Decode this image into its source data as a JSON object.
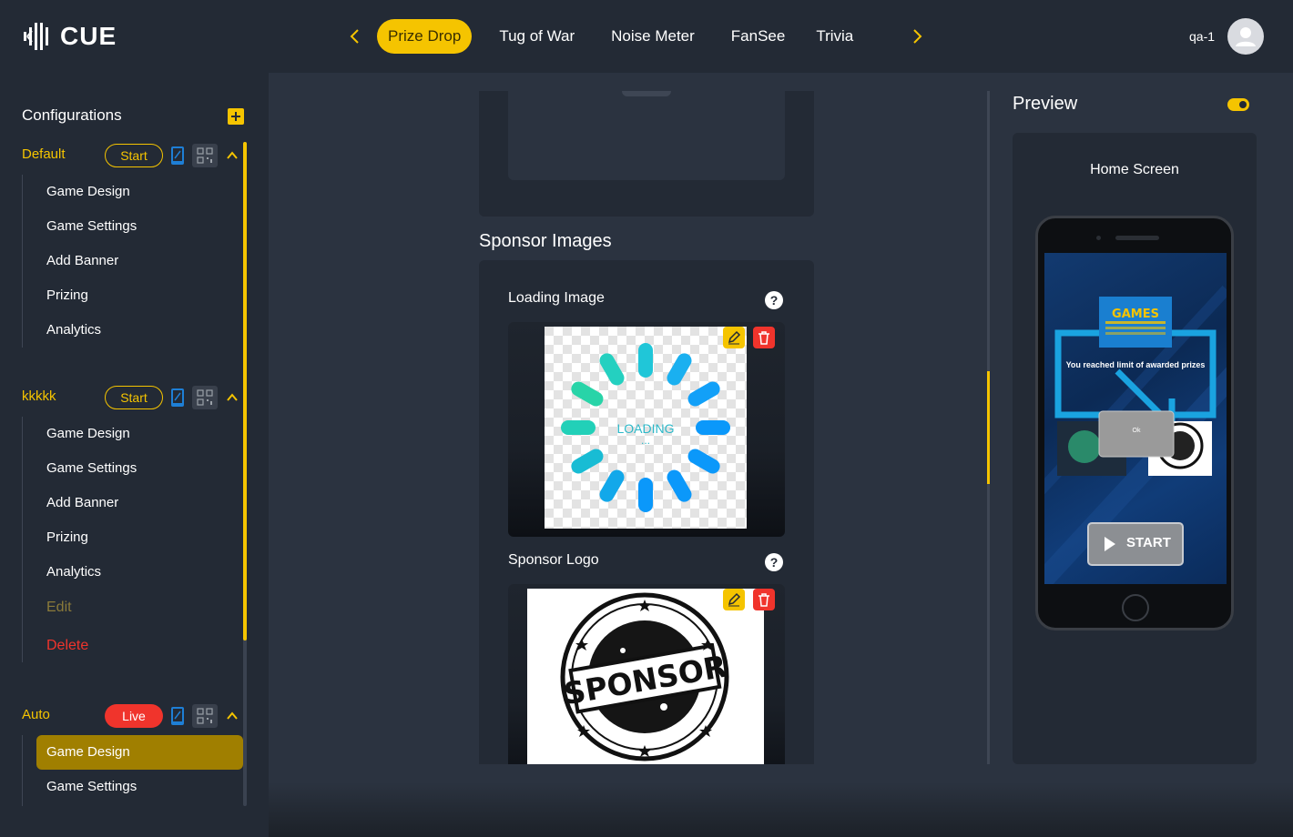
{
  "brand": {
    "name": "CUE"
  },
  "top_nav": {
    "tabs": [
      {
        "label": "Prize Drop",
        "active": true
      },
      {
        "label": "Tug of War",
        "active": false
      },
      {
        "label": "Noise Meter",
        "active": false
      },
      {
        "label": "FanSee",
        "active": false
      },
      {
        "label": "Trivia",
        "active": false
      }
    ],
    "user": {
      "name": "qa-1"
    }
  },
  "sidebar": {
    "title": "Configurations",
    "groups": [
      {
        "name": "Default",
        "status_label": "Start",
        "items": [
          "Game Design",
          "Game Settings",
          "Add Banner",
          "Prizing",
          "Analytics"
        ]
      },
      {
        "name": "kkkkk",
        "status_label": "Start",
        "items": [
          "Game Design",
          "Game Settings",
          "Add Banner",
          "Prizing",
          "Analytics"
        ],
        "actions": {
          "edit": "Edit",
          "delete": "Delete"
        }
      },
      {
        "name": "Auto",
        "status_label": "Live",
        "items": [
          "Game Design",
          "Game Settings"
        ],
        "active_item": "Game Design"
      }
    ]
  },
  "main": {
    "section_title": "Sponsor Images",
    "fields": [
      {
        "label": "Loading Image",
        "image_text": "LOADING",
        "image_dots": "..."
      },
      {
        "label": "Sponsor Logo",
        "image_text": "SPONSOR"
      }
    ]
  },
  "preview": {
    "title": "Preview",
    "toggle_on": true,
    "screen_title": "Home Screen",
    "phone": {
      "games_logo": "GAMES",
      "message": "You reached limit of awarded prizes",
      "ok_label": "Ok",
      "start_label": "START"
    }
  },
  "colors": {
    "accent": "#f5c400",
    "live": "#f0342c",
    "sidebar_bg": "#232a35",
    "main_bg": "#2b3340"
  }
}
